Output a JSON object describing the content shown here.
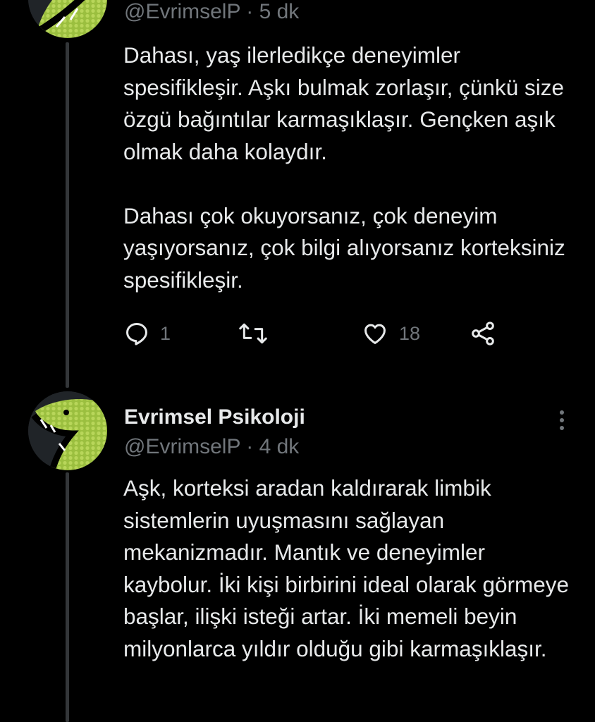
{
  "colors": {
    "background": "#000000",
    "text_primary": "#e7e9ea",
    "text_secondary": "#71767b",
    "thread_line": "#333639"
  },
  "tweets": [
    {
      "author_name": "",
      "handle_time": "@EvrimselP · 5 dk",
      "avatar_icon": "green-snake-avatar",
      "paragraphs": [
        "Dahası, yaş ilerledikçe deneyimler spesifikleşir. Aşkı bulmak zorlaşır, çünkü size özgü bağıntılar karmaşıklaşır. Gençken aşık olmak daha kolaydır.",
        "Dahası çok okuyorsanız, çok deneyim yaşıyorsanız, çok bilgi alıyorsanız korteksiniz spesifikleşir."
      ],
      "actions": {
        "reply_icon": "reply-icon",
        "reply_count": "1",
        "retweet_icon": "retweet-icon",
        "retweet_count": "",
        "like_icon": "heart-icon",
        "like_count": "18",
        "share_icon": "share-icon"
      }
    },
    {
      "author_name": "Evrimsel Psikoloji",
      "handle_time": "@EvrimselP · 4 dk",
      "avatar_icon": "green-snake-avatar",
      "more_icon": "more-vertical-icon",
      "paragraphs": [
        "Aşk, korteksi aradan kaldırarak limbik sistemlerin uyuşmasını sağlayan mekanizmadır. Mantık ve deneyimler kaybolur. İki kişi birbirini ideal olarak görmeye başlar, ilişki isteği artar. İki memeli beyin milyonlarca yıldır olduğu gibi karmaşıklaşır."
      ]
    }
  ]
}
